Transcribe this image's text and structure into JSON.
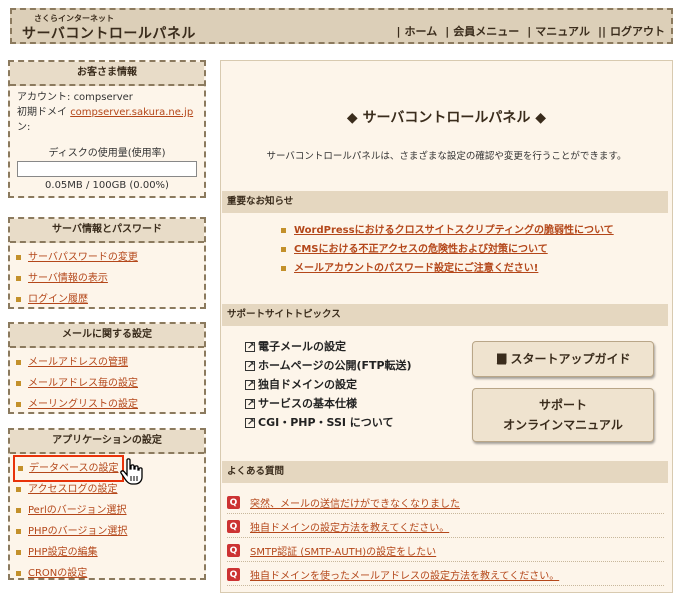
{
  "header": {
    "logo_small": "さくらインターネット",
    "logo_main": "サーバコントロールパネル",
    "nav": [
      {
        "label": "ホーム",
        "marker": "|"
      },
      {
        "label": "会員メニュー",
        "marker": "|"
      },
      {
        "label": "マニュアル",
        "marker": "|"
      },
      {
        "label": "ログアウト",
        "marker": "||"
      }
    ]
  },
  "customer": {
    "title": "お客さま情報",
    "account_label": "アカウント:",
    "account_value": "compserver",
    "domain_label_1": "初期ドメイ",
    "domain_value": "compserver.sakura.ne.jp",
    "domain_label_2": "ン:",
    "disk_label": "ディスクの使用量(使用率)",
    "disk_value": "0.05MB / 100GB (0.00%)",
    "disk_fraction": 0.0
  },
  "server_info": {
    "title": "サーバ情報とパスワード",
    "items": [
      "サーバパスワードの変更",
      "サーバ情報の表示",
      "ログイン履歴"
    ]
  },
  "mail": {
    "title": "メールに関する設定",
    "items": [
      "メールアドレスの管理",
      "メールアドレス毎の設定",
      "メーリングリストの設定"
    ]
  },
  "apps": {
    "title": "アプリケーションの設定",
    "items": [
      "データベースの設定",
      "アクセスログの設定",
      "Perlのバージョン選択",
      "PHPのバージョン選択",
      "PHP設定の編集",
      "CRONの設定"
    ]
  },
  "main": {
    "title": "◆ サーバコントロールパネル ◆",
    "description": "サーバコントロールパネルは、さまざまな設定の確認や変更を行うことができます。",
    "news_title": "重要なお知らせ",
    "news": [
      "WordPressにおけるクロスサイトスクリプティングの脆弱性について",
      "CMSにおける不正アクセスの危険性および対策について",
      "メールアカウントのパスワード設定にご注意ください!"
    ],
    "support_title": "サポートサイトトピックス",
    "topics": [
      "電子メールの設定",
      "ホームページの公開(FTP転送)",
      "独自ドメインの設定",
      "サービスの基本仕様",
      "CGI・PHP・SSI について"
    ],
    "startup_button": "スタートアップガイド",
    "manual_button_1": "サポート",
    "manual_button_2": "オンラインマニュアル",
    "faq_title": "よくある質問",
    "faq_icon": "Q",
    "faq": [
      "突然、メールの送信だけができなくなりました",
      "独自ドメインの設定方法を教えてください。",
      "SMTP認証 (SMTP-AUTH)の設定をしたい",
      "独自ドメインを使ったメールアドレスの設定方法を教えてください。"
    ]
  }
}
